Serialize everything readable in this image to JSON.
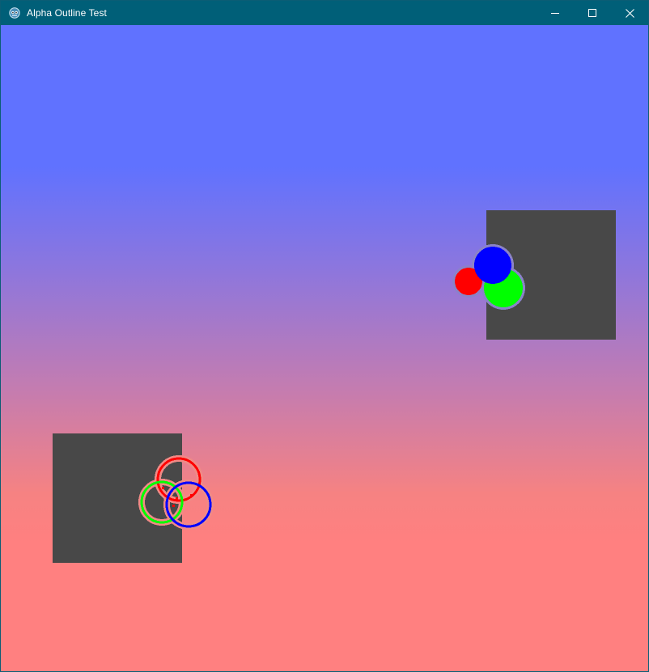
{
  "window": {
    "title": "Alpha Outline Test",
    "app_icon": "godot-icon",
    "controls": {
      "minimize": "minimize-icon",
      "maximize": "maximize-icon",
      "close": "close-icon"
    }
  },
  "colors": {
    "titlebar": "#005f78",
    "gradient_top": "#6072ff",
    "gradient_bottom": "#ff8080",
    "panel": "#484848",
    "red": "#ff0000",
    "green": "#00ff00",
    "blue": "#0000ff",
    "filled_outline": "#8a82c8",
    "ring_outline": "#f08a86"
  },
  "scene": {
    "filled_group": {
      "panel": "dark-square",
      "circles": [
        "red",
        "green",
        "blue"
      ],
      "style": "filled"
    },
    "ring_group": {
      "panel": "dark-square",
      "circles": [
        "red",
        "green",
        "blue"
      ],
      "style": "ring"
    }
  }
}
